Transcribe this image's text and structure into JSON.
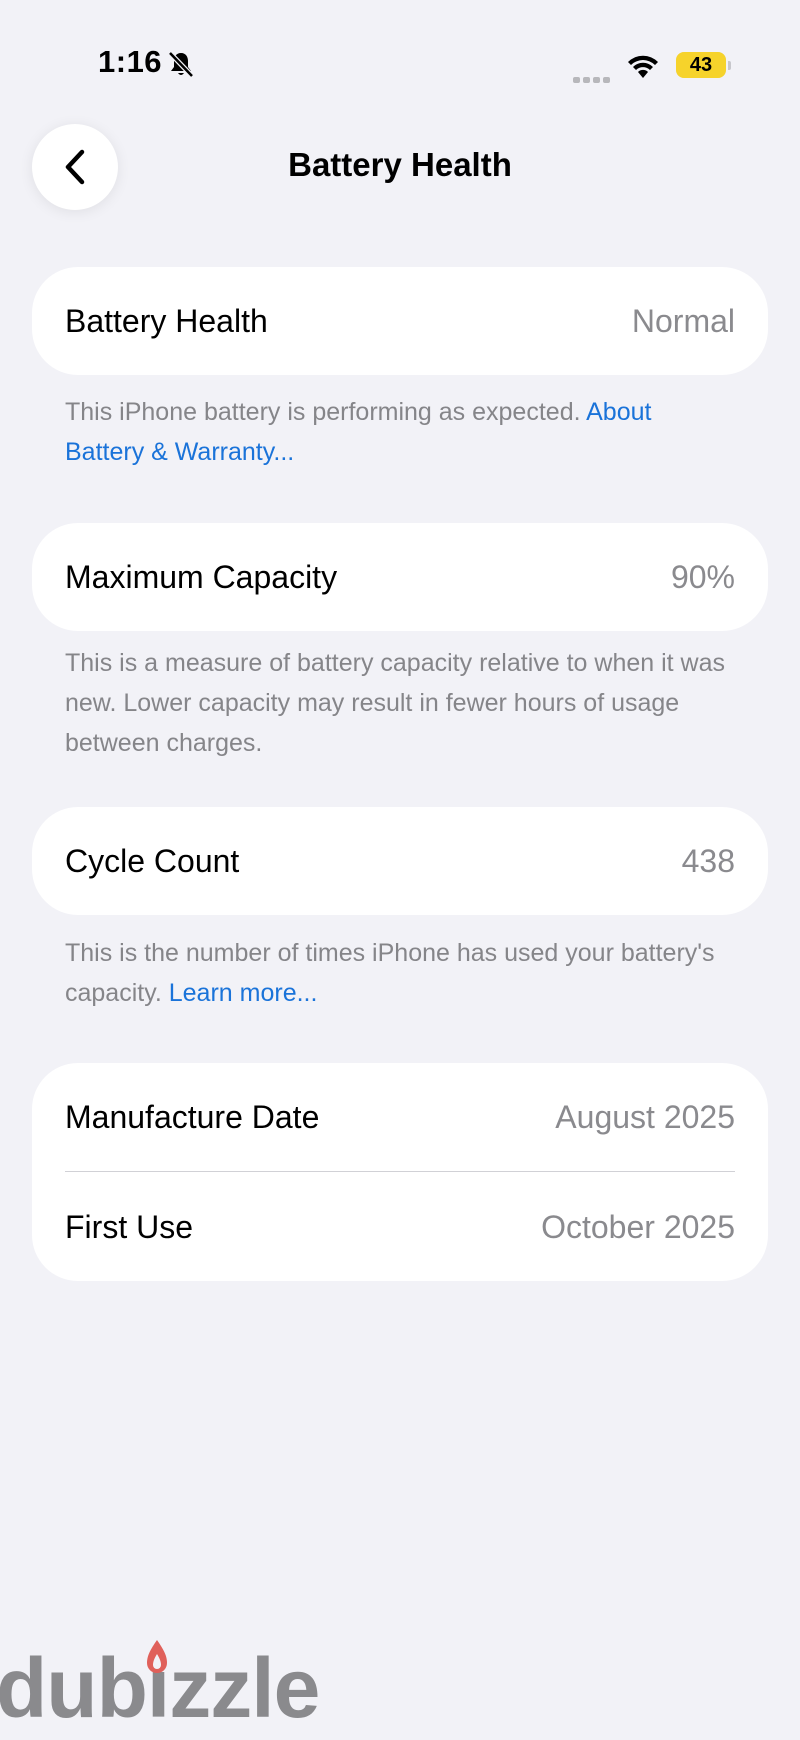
{
  "status_bar": {
    "time": "1:16",
    "battery_level": "43",
    "battery_fraction": 0.43,
    "icons": [
      "bell-slash-icon",
      "cellular-signal-icon",
      "wifi-icon",
      "battery-icon"
    ]
  },
  "nav": {
    "back_icon": "chevron-left-icon",
    "title": "Battery Health"
  },
  "battery_health": {
    "label": "Battery Health",
    "value": "Normal",
    "footnote_text": "This iPhone battery is performing as expected. ",
    "footnote_link": "About Battery & Warranty..."
  },
  "maximum_capacity": {
    "label": "Maximum Capacity",
    "value": "90%",
    "footnote_text": "This is a measure of battery capacity relative to when it was new. Lower capacity may result in fewer hours of usage between charges."
  },
  "cycle_count": {
    "label": "Cycle Count",
    "value": "438",
    "footnote_text": "This is the number of times iPhone has used your battery's capacity. ",
    "footnote_link": "Learn more..."
  },
  "dates": {
    "manufacture_label": "Manufacture Date",
    "manufacture_value": "August 2025",
    "first_use_label": "First Use",
    "first_use_value": "October 2025"
  },
  "watermark": {
    "text": "dubizzle"
  },
  "colors": {
    "background": "#f2f2f7",
    "card": "#ffffff",
    "link": "#1a73d9",
    "secondary_text": "#8a8a8e",
    "battery_fill": "#f6d32b",
    "watermark_flame": "#e0605a"
  }
}
